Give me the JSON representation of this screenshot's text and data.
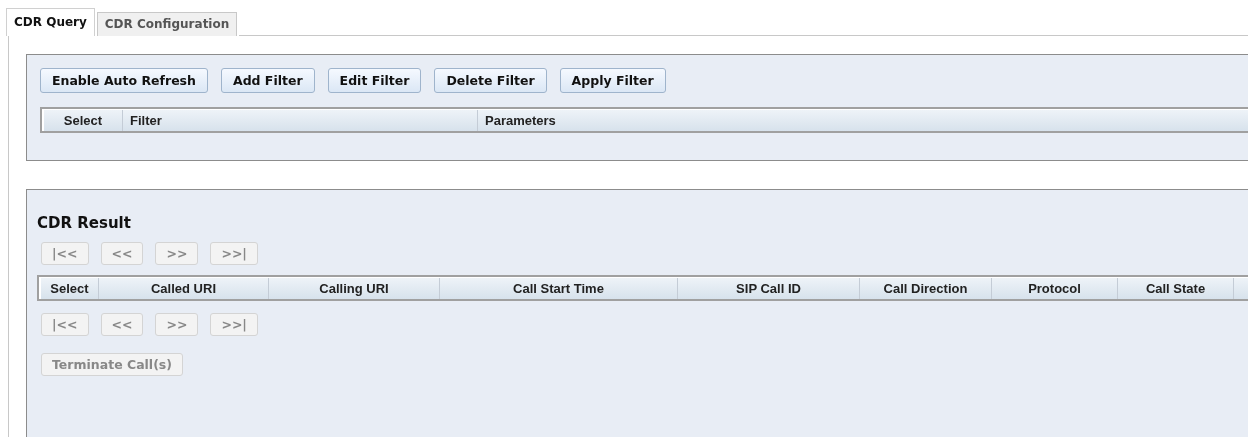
{
  "tabs": [
    {
      "label": "CDR Query",
      "selected": true
    },
    {
      "label": "CDR Configuration",
      "selected": false
    }
  ],
  "filter_panel": {
    "buttons": [
      {
        "label": "Enable Auto Refresh",
        "disabled": false
      },
      {
        "label": "Add Filter",
        "disabled": false
      },
      {
        "label": "Edit Filter",
        "disabled": false
      },
      {
        "label": "Delete Filter",
        "disabled": false
      },
      {
        "label": "Apply Filter",
        "disabled": false
      }
    ],
    "table": {
      "columns": [
        "Select",
        "Filter",
        "Parameters"
      ]
    }
  },
  "result_panel": {
    "title": "CDR Result",
    "pager_top": [
      {
        "label": "|<<",
        "disabled": true
      },
      {
        "label": "<<",
        "disabled": true
      },
      {
        "label": ">>",
        "disabled": true
      },
      {
        "label": ">>|",
        "disabled": true
      }
    ],
    "table": {
      "columns": [
        "Select",
        "Called URI",
        "Calling URI",
        "Call Start Time",
        "SIP Call ID",
        "Call Direction",
        "Protocol",
        "Call State"
      ]
    },
    "pager_bottom": [
      {
        "label": "|<<",
        "disabled": true
      },
      {
        "label": "<<",
        "disabled": true
      },
      {
        "label": ">>",
        "disabled": true
      },
      {
        "label": ">>|",
        "disabled": true
      }
    ],
    "terminate_button": {
      "label": "Terminate Call(s)",
      "disabled": true
    }
  }
}
